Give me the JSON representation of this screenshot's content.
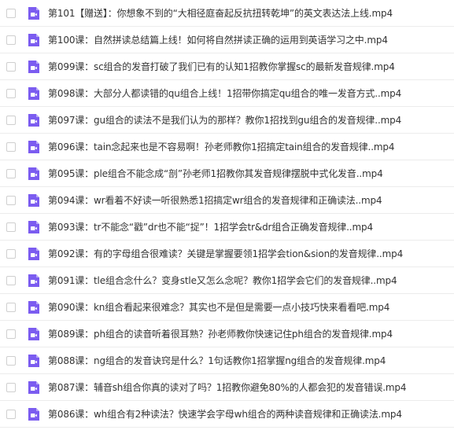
{
  "file_list": {
    "icon": "video-file-icon",
    "icon_color": "#7b5cf0",
    "items": [
      "第101【赠送】：你想象不到的“大相径庭奋起反抗扭转乾坤”的英文表达法上线.mp4",
      "第100课：自然拼读总结篇上线！如何将自然拼读正确的运用到英语学习之中.mp4",
      "第099课：sc组合的发音打破了我们已有的认知1招教你掌握sc的最新发音规律.mp4",
      "第098课：大部分人都读错的qu组合上线！1招带你搞定qu组合的唯一发音方式..mp4",
      "第097课：gu组合的读法不是我们认为的那样？教你1招找到gu组合的发音规律..mp4",
      "第096课：tain念起来也是不容易啊！孙老师教你1招搞定tain组合的发音规律..mp4",
      "第095课：ple组合不能念成“剖”孙老师1招教你其发音规律摆脱中式化发音..mp4",
      "第094课：wr看着不好读一听很熟悉1招搞定wr组合的发音规律和正确读法..mp4",
      "第093课：tr不能念“戳”dr也不能“捉”！1招学会tr&dr组合正确发音规律..mp4",
      "第092课：有的字母组合很难读？关键是掌握要领1招学会tion&sion的发音规律..mp4",
      "第091课：tle组合念什么？变身stle又怎么念呢？教你1招学会它们的发音规律..mp4",
      "第090课：kn组合看起来很难念？其实也不是但是需要一点小技巧快来看看吧.mp4",
      "第089课：ph组合的读音听着很耳熟？孙老师教你快速记住ph组合的发音规律.mp4",
      "第088课：ng组合的发音诀窍是什么？1句话教你1招掌握ng组合的发音规律.mp4",
      "第087课：辅音sh组合你真的读对了吗？1招教你避免80%的人都会犯的发音错误.mp4",
      "第086课：wh组合有2种读法？快速学会字母wh组合的两种读音规律和正确读法.mp4"
    ]
  }
}
